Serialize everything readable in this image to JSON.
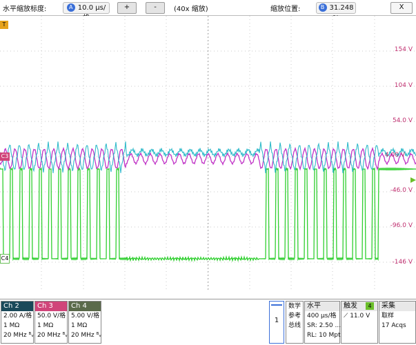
{
  "zoom_bar": {
    "h_zoom_label": "水平缩放标度:",
    "h_zoom_value": "10.0 μs/格",
    "plus_label": "+",
    "minus_label": "-",
    "zoom_factor": "(40x 缩放)",
    "zoom_position_label": "缩放位置:",
    "zoom_position_value": "31.248 %",
    "close_label": "X",
    "knob_a": "A",
    "knob_b": "B"
  },
  "markers": {
    "trigger": "T",
    "c3": "C3",
    "c4": "C4"
  },
  "volt_labels": [
    "154 V",
    "104 V",
    "54.0 V",
    "4.00 V",
    "-46.0 V",
    "-96.0 V",
    "-146 V"
  ],
  "channels": [
    {
      "name": "Ch 2",
      "scale": "2.00 A/格",
      "impedance": "1 MΩ",
      "bandwidth": "20 MHz",
      "color": "#1a4a5a"
    },
    {
      "name": "Ch 3",
      "scale": "50.0 V/格",
      "impedance": "1 MΩ",
      "bandwidth": "20 MHz",
      "color": "#d0457a"
    },
    {
      "name": "Ch 4",
      "scale": "5.00 V/格",
      "impedance": "1 MΩ",
      "bandwidth": "20 MHz",
      "color": "#5a6a4a"
    }
  ],
  "right_panel": {
    "ref_number": "1",
    "ref_label_1": "数学",
    "ref_label_2": "参考",
    "ref_label_3": "总线",
    "horizontal_title": "水平",
    "horizontal_scale": "400 μs/格",
    "sample_rate": "SR: 2.50 ...",
    "record_length": "RL: 10 Mpts",
    "trigger_title": "触发",
    "trigger_channel": "4",
    "trigger_level": "11.0 V",
    "acq_title": "采集",
    "acq_mode": "取样",
    "acq_count": "17 Acqs"
  },
  "colors": {
    "ch2_trace": "#19b3c4",
    "ch3_trace": "#c033c6",
    "ch4_trace": "#2fcf2f",
    "grid": "#c8c8c8"
  }
}
